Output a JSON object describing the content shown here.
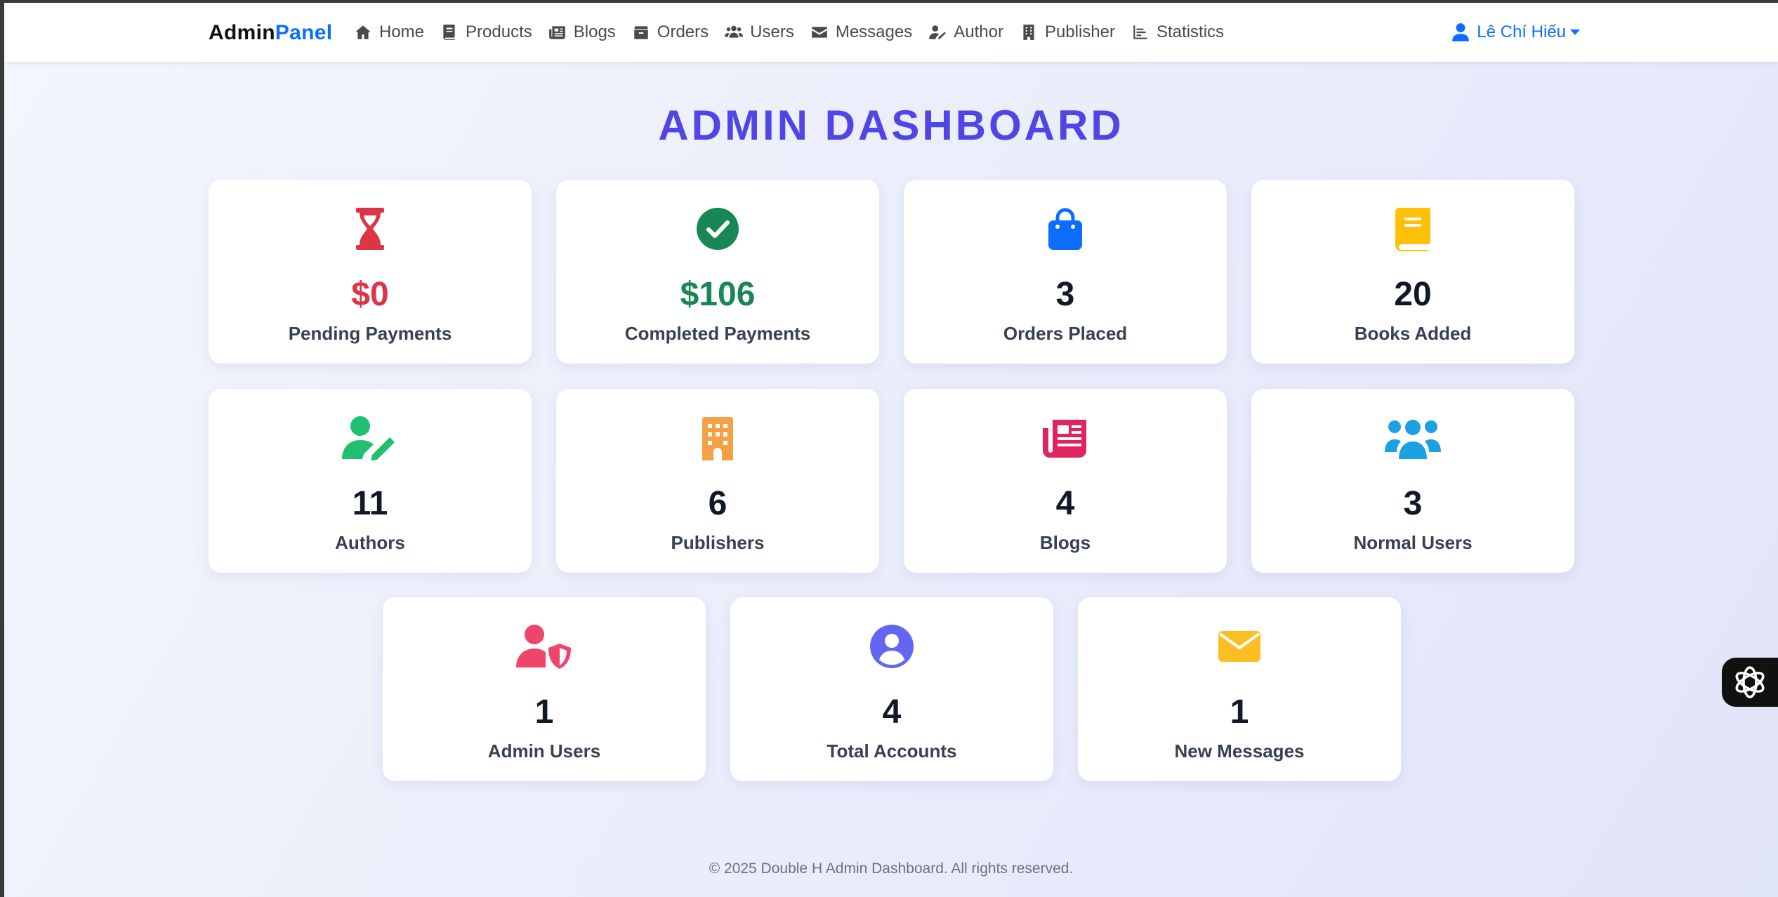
{
  "brand": {
    "main": "Admin",
    "accent": "Panel"
  },
  "nav": [
    {
      "label": "Home",
      "icon": "home-icon"
    },
    {
      "label": "Products",
      "icon": "book-icon"
    },
    {
      "label": "Blogs",
      "icon": "newspaper-icon"
    },
    {
      "label": "Orders",
      "icon": "box-icon"
    },
    {
      "label": "Users",
      "icon": "users-icon"
    },
    {
      "label": "Messages",
      "icon": "envelope-icon"
    },
    {
      "label": "Author",
      "icon": "user-pen-icon"
    },
    {
      "label": "Publisher",
      "icon": "building-icon"
    },
    {
      "label": "Statistics",
      "icon": "chart-icon"
    }
  ],
  "user": {
    "name": "Lê Chí Hiếu"
  },
  "title": "ADMIN DASHBOARD",
  "cards": [
    {
      "value": "$0",
      "label": "Pending Payments",
      "icon": "hourglass-icon",
      "color": "#dc3545"
    },
    {
      "value": "$106",
      "label": "Completed Payments",
      "icon": "check-circle-icon",
      "color": "#198754"
    },
    {
      "value": "3",
      "label": "Orders Placed",
      "icon": "shopping-bag-icon",
      "color": "#0d6efd"
    },
    {
      "value": "20",
      "label": "Books Added",
      "icon": "book-icon",
      "color": "#ffc107"
    },
    {
      "value": "11",
      "label": "Authors",
      "icon": "user-pen-icon",
      "color": "#20c070"
    },
    {
      "value": "6",
      "label": "Publishers",
      "icon": "building-icon",
      "color": "#f5a042"
    },
    {
      "value": "4",
      "label": "Blogs",
      "icon": "newspaper-icon",
      "color": "#e0245e"
    },
    {
      "value": "3",
      "label": "Normal Users",
      "icon": "users-icon",
      "color": "#1ba1e2"
    },
    {
      "value": "1",
      "label": "Admin Users",
      "icon": "user-shield-icon",
      "color": "#f0456a"
    },
    {
      "value": "4",
      "label": "Total Accounts",
      "icon": "user-circle-icon",
      "color": "#6366f1"
    },
    {
      "value": "1",
      "label": "New Messages",
      "icon": "envelope-icon",
      "color": "#fbbf24"
    }
  ],
  "footer": "© 2025 Double H Admin Dashboard. All rights reserved."
}
